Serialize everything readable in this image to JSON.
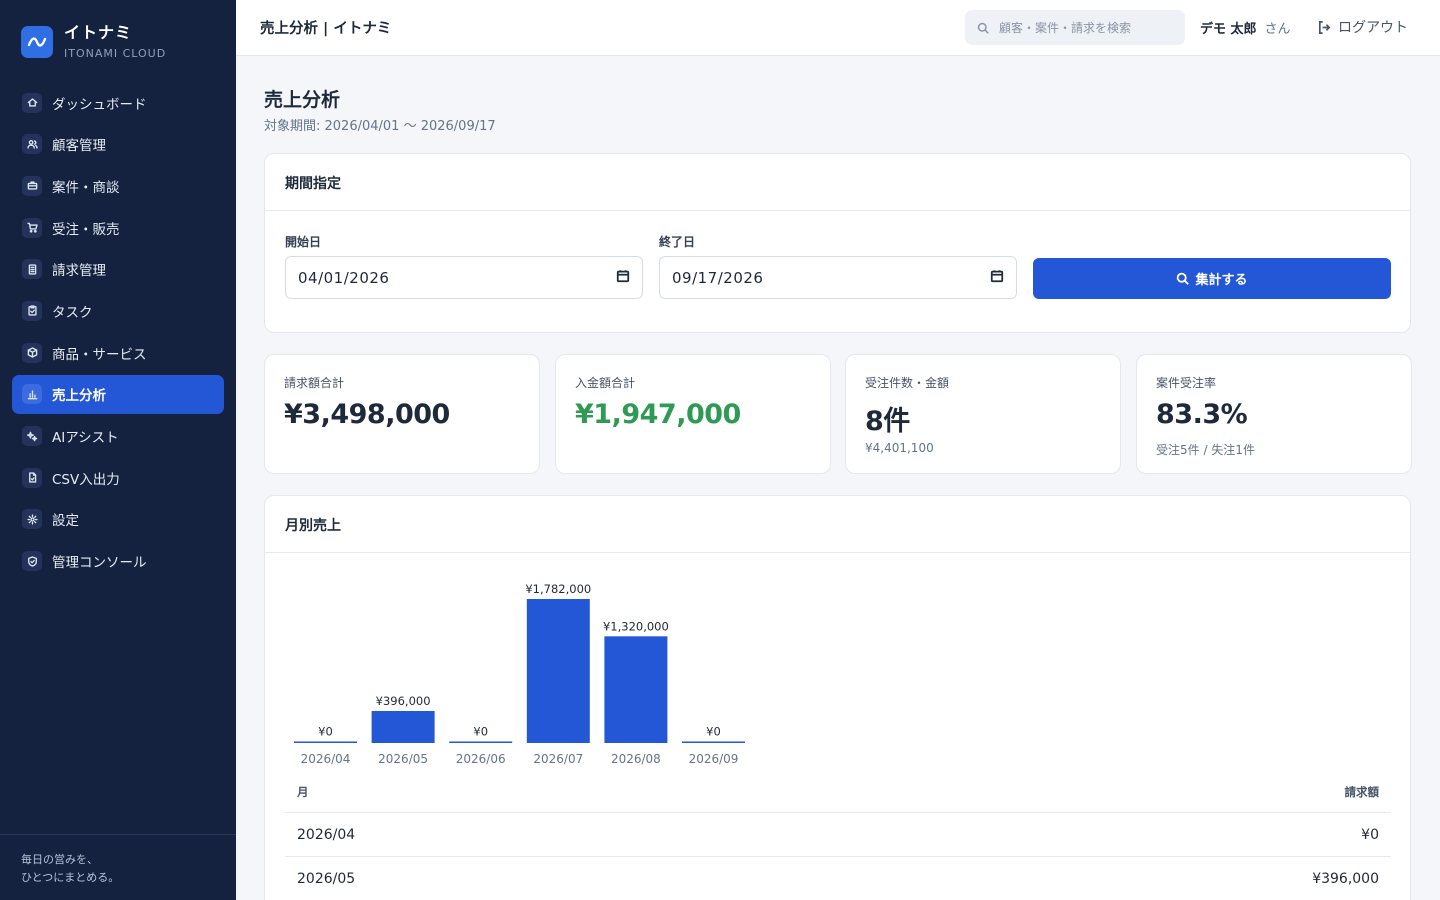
{
  "brand": {
    "name": "イトナミ",
    "sub": "ITONAMI CLOUD"
  },
  "sidebar": {
    "items": [
      {
        "label": "ダッシュボード",
        "icon": "home-icon"
      },
      {
        "label": "顧客管理",
        "icon": "users-icon"
      },
      {
        "label": "案件・商談",
        "icon": "briefcase-icon"
      },
      {
        "label": "受注・販売",
        "icon": "cart-icon"
      },
      {
        "label": "請求管理",
        "icon": "invoice-icon"
      },
      {
        "label": "タスク",
        "icon": "clipboard-icon"
      },
      {
        "label": "商品・サービス",
        "icon": "box-icon"
      },
      {
        "label": "売上分析",
        "icon": "bar-chart-icon",
        "active": true
      },
      {
        "label": "AIアシスト",
        "icon": "sparkle-icon"
      },
      {
        "label": "CSV入出力",
        "icon": "file-icon"
      },
      {
        "label": "設定",
        "icon": "gear-icon"
      },
      {
        "label": "管理コンソール",
        "icon": "shield-icon"
      }
    ],
    "footer_line1": "毎日の営みを、",
    "footer_line2": "ひとつにまとめる。"
  },
  "header": {
    "title": "売上分析 | イトナミ",
    "search_placeholder": "顧客・案件・請求を検索",
    "user_name": "デモ 太郎",
    "user_suffix": "さん",
    "logout": "ログアウト"
  },
  "page": {
    "title": "売上分析",
    "subtitle": "対象期間: 2026/04/01 〜 2026/09/17"
  },
  "period": {
    "heading": "期間指定",
    "start_label": "開始日",
    "start_value": "04/01/2026",
    "end_label": "終了日",
    "end_value": "09/17/2026",
    "button": "集計する"
  },
  "kpis": [
    {
      "label": "請求額合計",
      "value": "¥3,498,000",
      "sub": "",
      "color": "#1e293b"
    },
    {
      "label": "入金額合計",
      "value": "¥1,947,000",
      "sub": "",
      "color": "#2e9a53"
    },
    {
      "label": "受注件数・金額",
      "value": "8件",
      "sub": "¥4,401,100",
      "color": "#1e293b"
    },
    {
      "label": "案件受注率",
      "value": "83.3%",
      "sub": "受注5件 / 失注1件",
      "color": "#1e293b"
    }
  ],
  "monthly": {
    "heading": "月別売上",
    "table_header_month": "月",
    "table_header_amount": "請求額",
    "rows": [
      {
        "month": "2026/04",
        "amount": "¥0"
      },
      {
        "month": "2026/05",
        "amount": "¥396,000"
      }
    ]
  },
  "chart_data": {
    "type": "bar",
    "categories": [
      "2026/04",
      "2026/05",
      "2026/06",
      "2026/07",
      "2026/08",
      "2026/09"
    ],
    "values": [
      0,
      396000,
      0,
      1782000,
      1320000,
      0
    ],
    "labels": [
      "¥0",
      "¥396,000",
      "¥0",
      "¥1,782,000",
      "¥1,320,000",
      "¥0"
    ],
    "bar_color": "#2357d6",
    "ylim": [
      0,
      1782000
    ]
  }
}
